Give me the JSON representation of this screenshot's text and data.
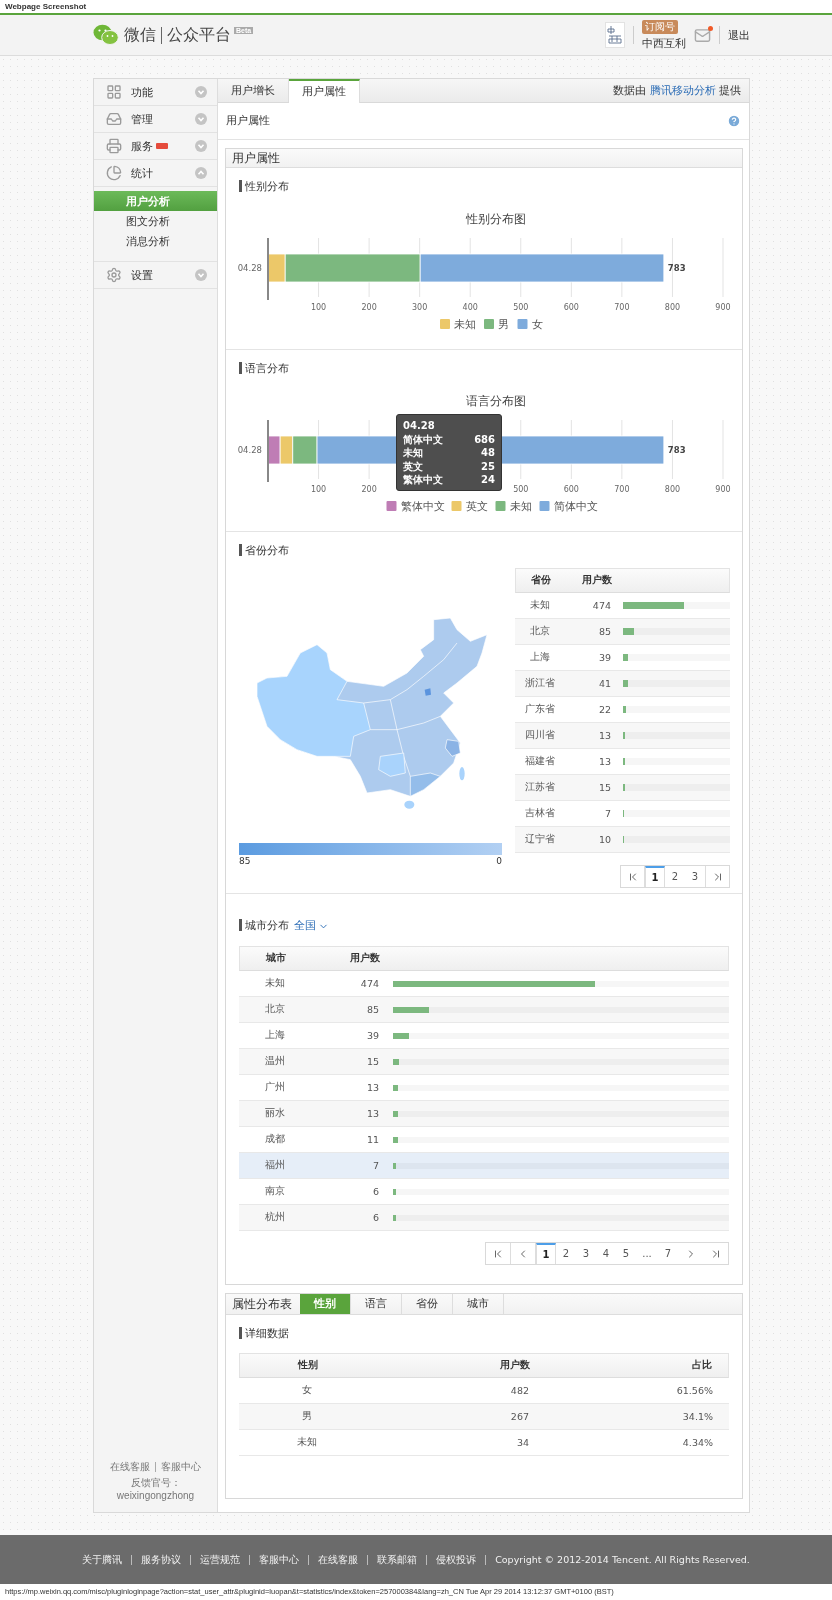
{
  "caption": "Webpage Screenshot",
  "header": {
    "brand": "微信",
    "product": "公众平台",
    "beta": "Beta",
    "account_type": "订阅号",
    "account_name": "中西互利",
    "mail_unread": true,
    "logout": "退出"
  },
  "sidebar": {
    "items": [
      {
        "label": "功能",
        "badge": false,
        "expanded": false
      },
      {
        "label": "管理",
        "badge": false,
        "expanded": false
      },
      {
        "label": "服务",
        "badge": true,
        "expanded": false
      },
      {
        "label": "统计",
        "badge": false,
        "expanded": true,
        "children": [
          {
            "label": "用户分析",
            "selected": true
          },
          {
            "label": "图文分析",
            "selected": false
          },
          {
            "label": "消息分析",
            "selected": false
          }
        ]
      },
      {
        "label": "设置",
        "badge": false,
        "expanded": false
      }
    ],
    "help_links": [
      "在线客服",
      "客服中心"
    ],
    "feedback": "反馈官号：weixingongzhong"
  },
  "tabs": [
    {
      "label": "用户增长",
      "selected": false
    },
    {
      "label": "用户属性",
      "selected": true
    }
  ],
  "data_source": {
    "prefix": "数据由",
    "link": "腾讯移动分析",
    "suffix": "提供"
  },
  "page_title": "用户属性",
  "panel": {
    "title": "用户属性",
    "gender": {
      "title": "性别分布",
      "chart_data": {
        "type": "bar",
        "orientation": "horizontal",
        "stacked": true,
        "title": "性别分布图",
        "categories": [
          "04.28"
        ],
        "series": [
          {
            "name": "未知",
            "color": "#ecc869",
            "values": [
              34
            ]
          },
          {
            "name": "男",
            "color": "#7cb87f",
            "values": [
              267
            ]
          },
          {
            "name": "女",
            "color": "#7eabdc",
            "values": [
              482
            ]
          }
        ],
        "xlim": [
          0,
          900
        ],
        "xticks": [
          100,
          200,
          300,
          400,
          500,
          600,
          700,
          800,
          900
        ],
        "grid": true,
        "legend": true,
        "annotations": [
          {
            "text": "783"
          }
        ]
      }
    },
    "language": {
      "title": "语言分布",
      "chart_data": {
        "type": "bar",
        "orientation": "horizontal",
        "stacked": true,
        "title": "语言分布图",
        "categories": [
          "04.28"
        ],
        "series": [
          {
            "name": "繁体中文",
            "color": "#bf7db5",
            "values": [
              24
            ]
          },
          {
            "name": "英文",
            "color": "#ecc869",
            "values": [
              25
            ]
          },
          {
            "name": "未知",
            "color": "#7cb87f",
            "values": [
              48
            ]
          },
          {
            "name": "简体中文",
            "color": "#7eabdc",
            "values": [
              686
            ]
          }
        ],
        "xlim": [
          0,
          900
        ],
        "xticks": [
          100,
          200,
          500,
          600,
          700,
          800,
          900
        ],
        "grid": true,
        "legend": true,
        "annotations": [
          {
            "text": "783"
          }
        ]
      },
      "tooltip": {
        "title": "04.28",
        "rows": [
          {
            "label": "简体中文",
            "value": "686"
          },
          {
            "label": "未知",
            "value": "48"
          },
          {
            "label": "英文",
            "value": "25"
          },
          {
            "label": "繁体中文",
            "value": "24"
          }
        ]
      }
    },
    "province": {
      "title": "省份分布",
      "legend": {
        "max": "85",
        "min": "0"
      },
      "columns": [
        "省份",
        "用户数"
      ],
      "rows": [
        {
          "name": "未知",
          "count": "474",
          "level": 0.571
        },
        {
          "name": "北京",
          "count": "85",
          "level": 0.102
        },
        {
          "name": "上海",
          "count": "39",
          "level": 0.047
        },
        {
          "name": "浙江省",
          "count": "41",
          "level": 0.049
        },
        {
          "name": "广东省",
          "count": "22",
          "level": 0.027
        },
        {
          "name": "四川省",
          "count": "13",
          "level": 0.016
        },
        {
          "name": "福建省",
          "count": "13",
          "level": 0.016
        },
        {
          "name": "江苏省",
          "count": "15",
          "level": 0.018
        },
        {
          "name": "吉林省",
          "count": "7",
          "level": 0.008
        },
        {
          "name": "辽宁省",
          "count": "10",
          "level": 0.012
        }
      ],
      "pagination": [
        {
          "kind": "first"
        },
        {
          "kind": "page",
          "label": "1",
          "selected": true
        },
        {
          "kind": "page",
          "label": "2",
          "selected": false
        },
        {
          "kind": "page",
          "label": "3",
          "selected": false
        },
        {
          "kind": "last"
        }
      ]
    },
    "city": {
      "title": "城市分布",
      "scope": "全国",
      "columns": [
        "城市",
        "用户数"
      ],
      "rows": [
        {
          "name": "未知",
          "count": "474",
          "level": 0.6,
          "selected": false
        },
        {
          "name": "北京",
          "count": "85",
          "level": 0.108,
          "selected": false
        },
        {
          "name": "上海",
          "count": "39",
          "level": 0.049,
          "selected": false
        },
        {
          "name": "温州",
          "count": "15",
          "level": 0.019,
          "selected": false
        },
        {
          "name": "广州",
          "count": "13",
          "level": 0.016,
          "selected": false
        },
        {
          "name": "丽水",
          "count": "13",
          "level": 0.016,
          "selected": false
        },
        {
          "name": "成都",
          "count": "11",
          "level": 0.014,
          "selected": false
        },
        {
          "name": "福州",
          "count": "7",
          "level": 0.009,
          "selected": true
        },
        {
          "name": "南京",
          "count": "6",
          "level": 0.008,
          "selected": false
        },
        {
          "name": "杭州",
          "count": "6",
          "level": 0.008,
          "selected": false
        }
      ],
      "pagination": [
        {
          "kind": "first"
        },
        {
          "kind": "prev"
        },
        {
          "kind": "page",
          "label": "1",
          "selected": true
        },
        {
          "kind": "page",
          "label": "2",
          "selected": false
        },
        {
          "kind": "page",
          "label": "3",
          "selected": false
        },
        {
          "kind": "page",
          "label": "4",
          "selected": false
        },
        {
          "kind": "page",
          "label": "5",
          "selected": false
        },
        {
          "kind": "ellipsis",
          "label": "..."
        },
        {
          "kind": "page",
          "label": "7",
          "selected": false
        },
        {
          "kind": "next"
        },
        {
          "kind": "last"
        }
      ]
    }
  },
  "attribute_table": {
    "title": "属性分布表",
    "tabs": [
      {
        "label": "性别",
        "selected": true
      },
      {
        "label": "语言",
        "selected": false
      },
      {
        "label": "省份",
        "selected": false
      },
      {
        "label": "城市",
        "selected": false
      }
    ],
    "section_title": "详细数据",
    "columns": [
      "性别",
      "用户数",
      "占比"
    ],
    "rows": [
      [
        "女",
        "482",
        "61.56%"
      ],
      [
        "男",
        "267",
        "34.1%"
      ],
      [
        "未知",
        "34",
        "4.34%"
      ]
    ]
  },
  "footer": {
    "links": [
      "关于腾讯",
      "服务协议",
      "运营规范",
      "客服中心",
      "在线客服",
      "联系邮箱",
      "侵权投诉"
    ],
    "copyright": "Copyright © 2012-2014 Tencent. All Rights Reserved."
  },
  "url_line": "https://mp.weixin.qq.com/misc/pluginloginpage?action=stat_user_attr&pluginid=luopan&t=statistics/index&token=257000384&lang=zh_CN Tue Apr 29 2014 13:12:37 GMT+0100 (BST)"
}
